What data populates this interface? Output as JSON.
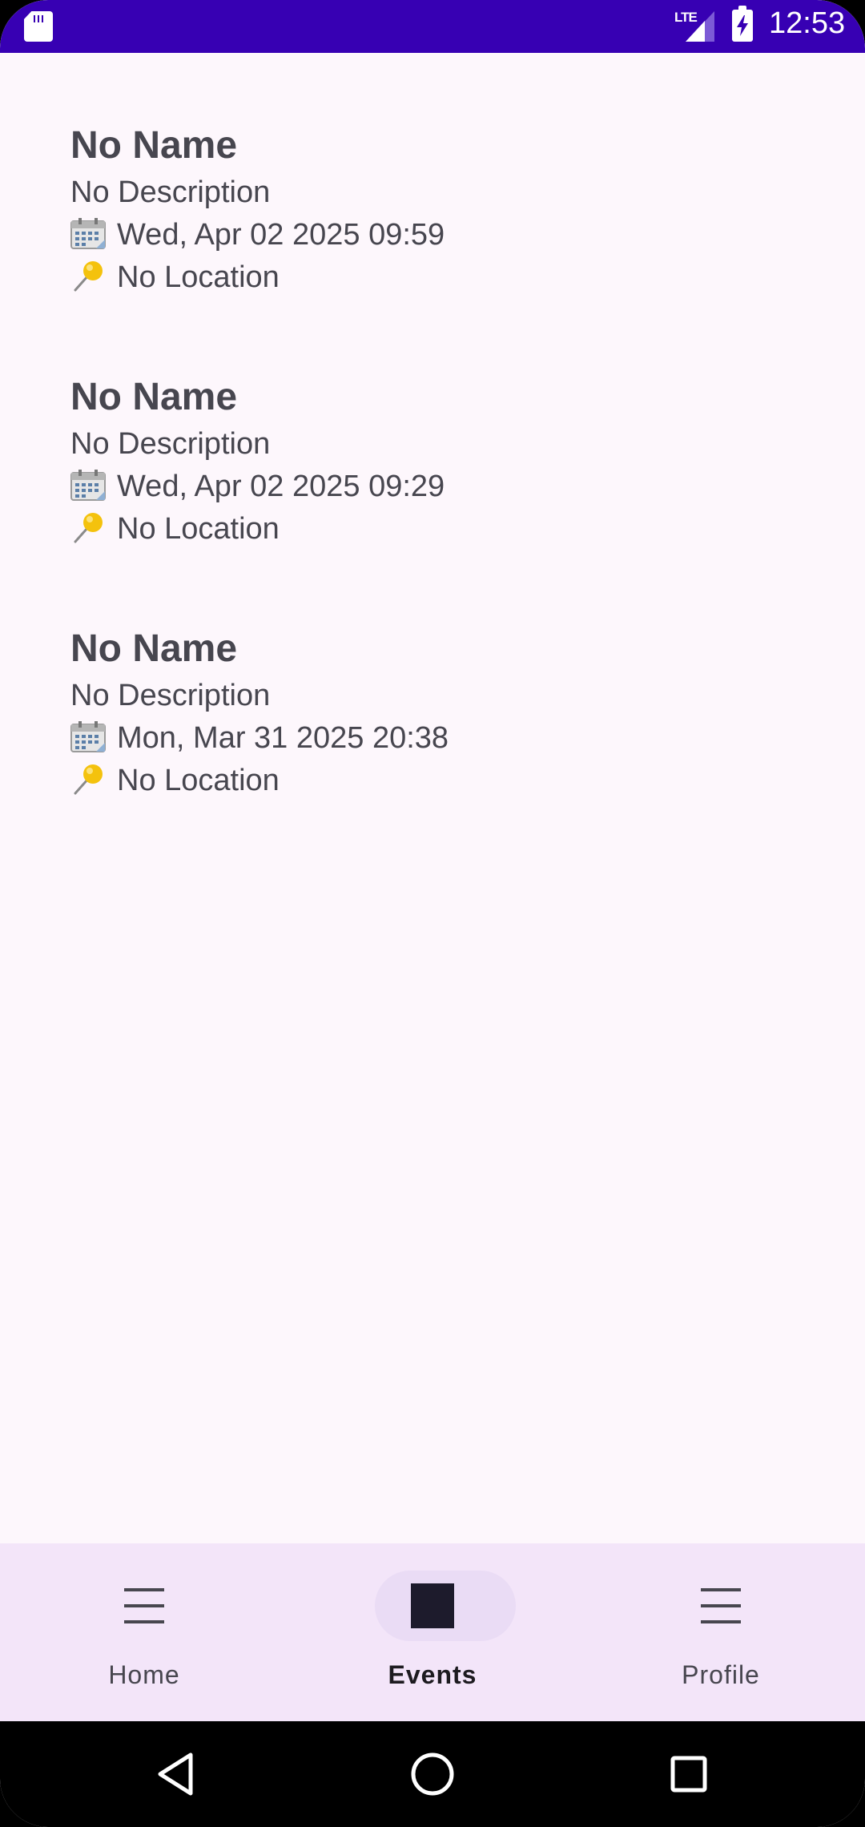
{
  "status_bar": {
    "network": "LTE",
    "time": "12:53",
    "background_color": "#3700b3",
    "icons": [
      "sd-card-icon",
      "signal-icon",
      "battery-charging-icon"
    ]
  },
  "events": [
    {
      "name": "No Name",
      "description": "No Description",
      "date": "Wed, Apr 02 2025 09:59",
      "location": "No Location"
    },
    {
      "name": "No Name",
      "description": "No Description",
      "date": "Wed, Apr 02 2025 09:29",
      "location": "No Location"
    },
    {
      "name": "No Name",
      "description": "No Description",
      "date": "Mon, Mar 31 2025 20:38",
      "location": "No Location"
    }
  ],
  "event_icons": {
    "date_icon": "calendar-icon",
    "location_icon": "pushpin-icon"
  },
  "bottom_nav": {
    "items": [
      {
        "label": "Home",
        "icon": "menu-icon",
        "active": false
      },
      {
        "label": "Events",
        "icon": "square-icon",
        "active": true
      },
      {
        "label": "Profile",
        "icon": "menu-icon",
        "active": false
      }
    ],
    "background_color": "#f3e5f9",
    "active_indicator_color": "#eadcf5"
  },
  "system_nav": {
    "buttons": [
      "back-icon",
      "home-circle-icon",
      "recents-icon"
    ]
  }
}
